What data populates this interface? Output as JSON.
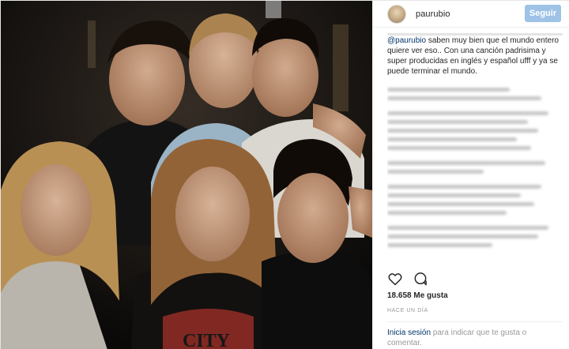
{
  "header": {
    "username": "paurubio",
    "follow_label": "Seguir"
  },
  "caption": {
    "mention": "@paurubio",
    "text": " saben muy bien que el mundo entero quiere ver eso.. Con una canción padrisima y super producidas en inglés y español ufff y ya se puede terminar el mundo."
  },
  "actions": {
    "like_icon": "heart-icon",
    "comment_icon": "comment-icon"
  },
  "likes": {
    "text": "18.658 Me gusta"
  },
  "timestamp": {
    "text": "HACE UN DÍA"
  },
  "login": {
    "link_text": "Inicia sesión",
    "rest_text": " para indicar que te gusta o comentar."
  },
  "photo": {
    "sign_text": "CITY"
  },
  "colors": {
    "follow_bg": "#9fc3e6",
    "link": "#003569",
    "text": "#262626",
    "muted": "#999999"
  }
}
